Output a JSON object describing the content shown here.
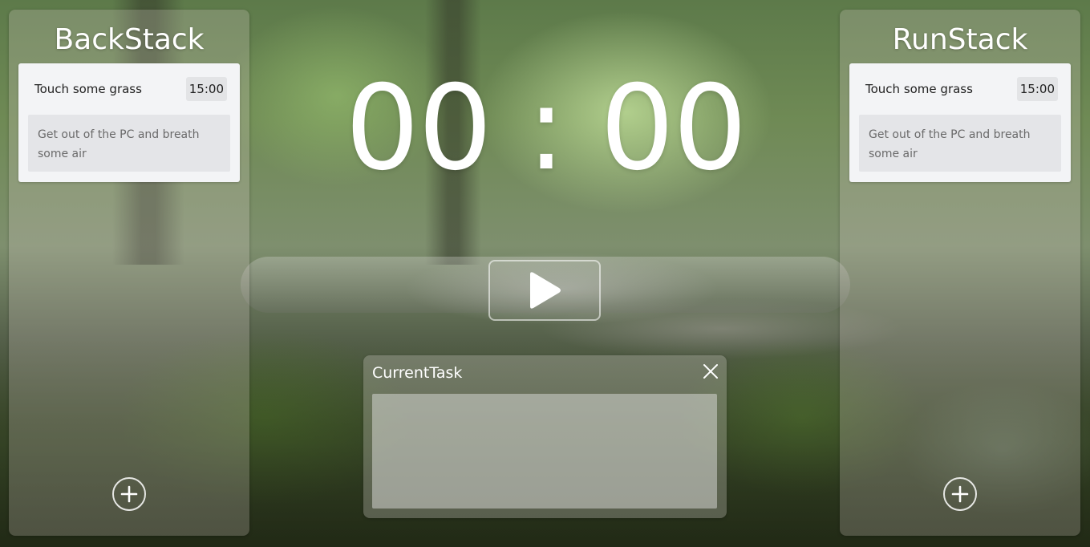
{
  "backstack": {
    "title": "BackStack",
    "tasks": [
      {
        "name": "Touch some grass",
        "time": "15:00",
        "description": "Get out of the PC and breath some air"
      }
    ],
    "add_icon": "plus-circle-icon"
  },
  "runstack": {
    "title": "RunStack",
    "tasks": [
      {
        "name": "Touch some grass",
        "time": "15:00",
        "description": "Get out of the PC and breath some air"
      }
    ],
    "add_icon": "plus-circle-icon"
  },
  "timer": {
    "display": "00 : 00"
  },
  "controls": {
    "play_icon": "play-icon"
  },
  "current_task": {
    "title": "CurrentTask",
    "close_icon": "close-icon",
    "content": ""
  },
  "colors": {
    "text": "#ffffff",
    "card_background": "#f3f4f6",
    "card_description_background": "#e4e5e8",
    "card_time_background": "#e3e4e6",
    "card_text": "#222222",
    "description_text": "#6a6a6a"
  }
}
